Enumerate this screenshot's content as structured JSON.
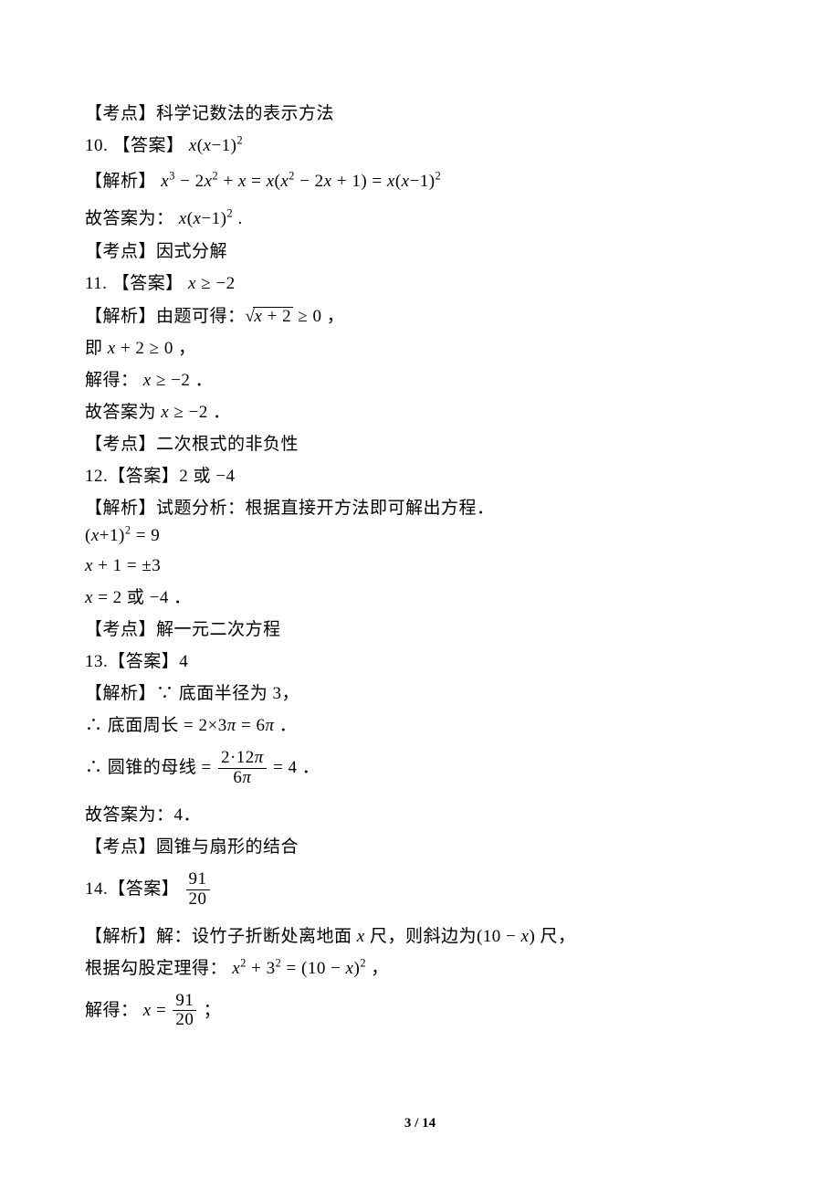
{
  "lines": {
    "l01": "【考点】科学记数法的表示方法",
    "l02_pre": "10. 【答案】 ",
    "l02_math": "x(x−1)<sup>2</sup>",
    "l03_pre": "【解析】 ",
    "l03_math": "x<sup>3</sup> − 2x<sup>2</sup> + x = x(x<sup>2</sup> − 2x + 1) = x(x−1)<sup>2</sup>",
    "l04_pre": "故答案为： ",
    "l04_math": "x(x−1)<sup>2</sup>",
    "l04_post": " .",
    "l05": "【考点】因式分解",
    "l06_pre": "11. 【答案】 ",
    "l06_math": "x ≥ −2",
    "l07_pre": "【解析】由题可得：",
    "l07_sqrt_arg": "x + 2",
    "l07_post": " ≥ 0 ，",
    "l08_pre": "即 ",
    "l08_math": "x + 2 ≥ 0",
    "l08_post": " ，",
    "l09_pre": "解得： ",
    "l09_math": "x ≥ −2",
    "l09_post": " ．",
    "l10_pre": "故答案为 ",
    "l10_math": "x ≥ −2",
    "l10_post": " ．",
    "l11": "【考点】二次根式的非负性",
    "l12_pre": "12.【答案】",
    "l12_math": "2 或 −4",
    "l13": "【解析】试题分析：根据直接开方法即可解出方程．",
    "l14_math": "(x+1)<sup>2</sup> = 9",
    "l15_math": "x + 1 = ±3",
    "l16_pre": "",
    "l16_math": "x = 2 或 −4",
    "l16_post": " ．",
    "l17": "【考点】解一元二次方程",
    "l18": "13.【答案】4",
    "l19": "【解析】∵ 底面半径为 3，",
    "l20_pre": "∴ 底面周长",
    "l20_math": " = 2×3π = 6π",
    "l20_post": " ．",
    "l21_pre": "∴ 圆锥的母线 = ",
    "l21_num": "2·12π",
    "l21_den": "6π",
    "l21_post": " = 4 ．",
    "l22": "故答案为：4．",
    "l23": "【考点】圆锥与扇形的结合",
    "l24_pre": "14.【答案】 ",
    "l24_num": "91",
    "l24_den": "20",
    "l25_pre": "【解析】解：设竹子折断处离地面 ",
    "l25_x": "x",
    "l25_mid": " 尺，则斜边为",
    "l25_math": "(10 − x)",
    "l25_post": " 尺，",
    "l26_pre": "据勾股定理得： ",
    "l26_math": "x<sup>2</sup> + 3<sup>2</sup> = (10 − x)<sup>2</sup>",
    "l26_post": " ，",
    "l27_pre": "解得： ",
    "l27_x": "x = ",
    "l27_num": "91",
    "l27_den": "20",
    "l27_post": " ；"
  },
  "footer": "3 / 14"
}
